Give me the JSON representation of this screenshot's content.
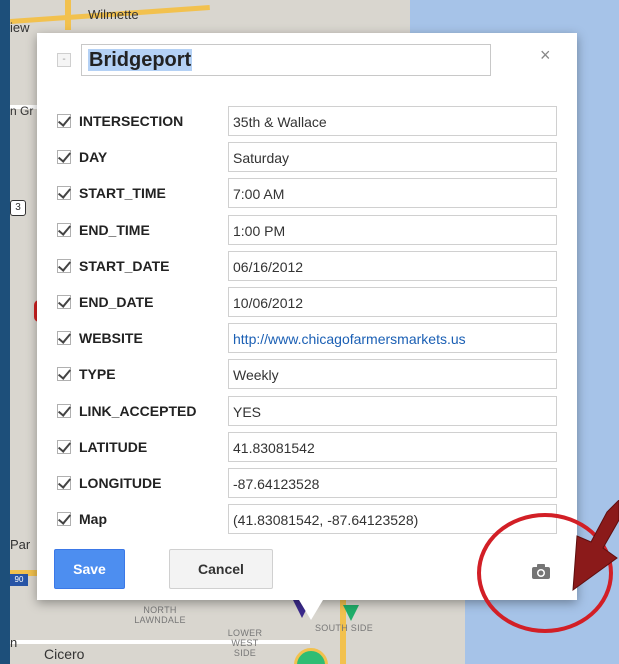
{
  "map": {
    "labels": {
      "wilmette": "Wilmette",
      "iew": "iew",
      "n_gr": "n Gr",
      "par": "Par",
      "n": "n",
      "cicero": "Cicero",
      "north_lawndale": "NORTH LAWNDALE",
      "lower_west_side": "LOWER WEST SIDE",
      "south_side": "SOUTH SIDE",
      "route_shield": "3",
      "route_shield2": "90"
    }
  },
  "dialog": {
    "title": "Bridgeport",
    "close_label": "×",
    "collapse_label": "-",
    "fields": [
      {
        "name": "INTERSECTION",
        "value": "35th & Wallace"
      },
      {
        "name": "DAY",
        "value": "Saturday"
      },
      {
        "name": "START_TIME",
        "value": "7:00 AM"
      },
      {
        "name": "END_TIME",
        "value": "1:00 PM"
      },
      {
        "name": "START_DATE",
        "value": "06/16/2012"
      },
      {
        "name": "END_DATE",
        "value": "10/06/2012"
      },
      {
        "name": "WEBSITE",
        "value": "http://www.chicagofarmersmarkets.us"
      },
      {
        "name": "TYPE",
        "value": "Weekly"
      },
      {
        "name": "LINK_ACCEPTED",
        "value": "YES"
      },
      {
        "name": "LATITUDE",
        "value": "41.83081542"
      },
      {
        "name": "LONGITUDE",
        "value": "-87.64123528"
      },
      {
        "name": "Map",
        "value": "(41.83081542, -87.64123528)"
      }
    ],
    "save_label": "Save",
    "cancel_label": "Cancel"
  },
  "colors": {
    "frame": "#1d4f7a",
    "save_button": "#4d8ef0",
    "link": "#1a5fb4",
    "annotation_red": "#d21f26",
    "arrow_fill": "#8b1a1a"
  },
  "icons": {
    "camera": "camera-icon",
    "close": "close-icon",
    "checkbox": "checkbox-checked-icon"
  }
}
